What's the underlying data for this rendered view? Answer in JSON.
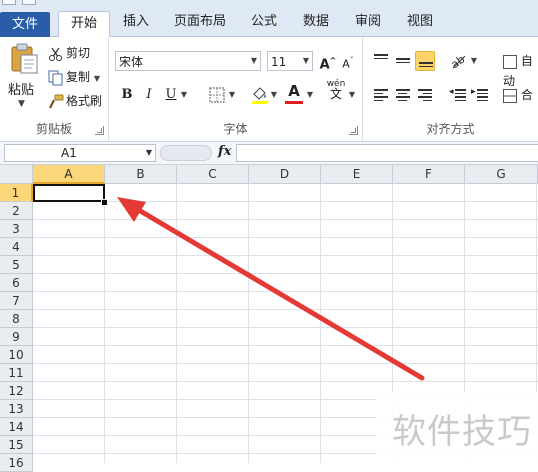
{
  "tabs": {
    "file": "文件",
    "home": "开始",
    "insert": "插入",
    "page_layout": "页面布局",
    "formulas": "公式",
    "data": "数据",
    "review": "审阅",
    "view": "视图"
  },
  "clipboard": {
    "paste": "粘贴",
    "cut": "剪切",
    "copy": "复制",
    "format_painter": "格式刷",
    "group_label": "剪贴板"
  },
  "font": {
    "font_name": "宋体",
    "font_size": "11",
    "bold": "B",
    "italic": "I",
    "underline": "U",
    "grow": "A",
    "shrink": "A",
    "font_color_letter": "A",
    "phonetic": "wén",
    "group_label": "字体"
  },
  "alignment": {
    "wrap": "自动",
    "merge": "合",
    "group_label": "对齐方式"
  },
  "formula_bar": {
    "name_box": "A1",
    "fx": "fx",
    "value": ""
  },
  "sheet": {
    "columns": [
      "A",
      "B",
      "C",
      "D",
      "E",
      "F",
      "G"
    ],
    "rows": [
      "1",
      "2",
      "3",
      "4",
      "5",
      "6",
      "7",
      "8",
      "9",
      "10",
      "11",
      "12",
      "13",
      "14",
      "15",
      "16"
    ],
    "selected_cell": "A1"
  },
  "annotation": {
    "arrow_color": "#e53935"
  },
  "watermark": "软件技巧",
  "colors": {
    "file_tab": "#2a5da8",
    "selection_header": "#fbd77a",
    "selected_align": "#fbd56b"
  }
}
